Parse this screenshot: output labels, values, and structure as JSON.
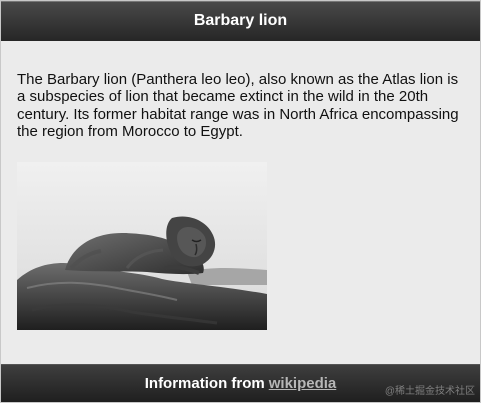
{
  "header": {
    "title": "Barbary lion"
  },
  "content": {
    "description": "The Barbary lion (Panthera leo leo), also known as the Atlas lion is a subspecies of lion that became extinct in the wild in the 20th century. Its former habitat range was in North Africa encompassing the region from Morocco to Egypt.",
    "image_alt": "Barbary lion lying on a rock"
  },
  "footer": {
    "prefix": "Information from",
    "link_label": "wikipedia"
  },
  "watermark": {
    "text": "@稀土掘金技术社区"
  }
}
